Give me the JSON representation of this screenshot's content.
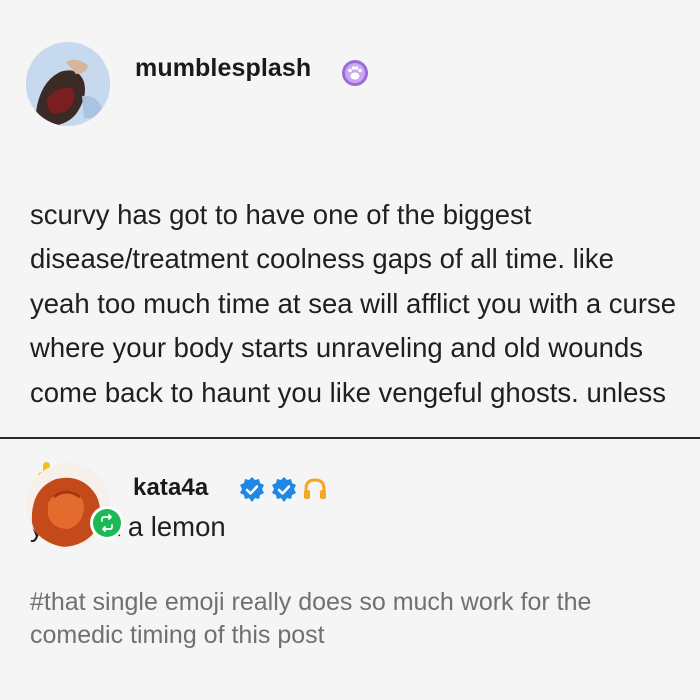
{
  "original_post": {
    "username": "mumblesplash",
    "badge_icon": "paw-badge-icon",
    "body_before_emoji": "scurvy has got to have one of the biggest disease/treatment coolness gaps of all time. like yeah too much time at sea will afflict you with a curse where your body starts unraveling and old wounds come back to haunt you like vengeful ghosts. unless",
    "emoji": "hand-pointing-up-emoji",
    "body_after_emoji": "you eat a lemon"
  },
  "reblog": {
    "username": "kata4a",
    "badges": [
      "verified-badge-icon",
      "verified-badge-icon",
      "headphones-icon"
    ],
    "reblog_badge_icon": "reblog-icon",
    "tags_text": "#that single emoji really does so much work for the comedic timing of this post"
  },
  "colors": {
    "background": "#f5f5f5",
    "text": "#1f1f1f",
    "tag_text": "#707070",
    "verified_blue": "#1e88e5",
    "reblog_green": "#1db954",
    "paw_purple": "#9b6bd6"
  }
}
